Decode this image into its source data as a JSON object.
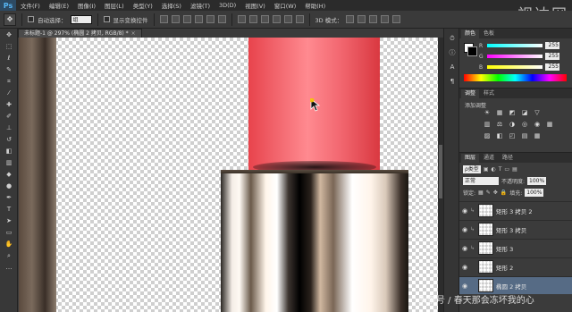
{
  "app": {
    "logo": "Ps",
    "menu": [
      "文件(F)",
      "编辑(E)",
      "图像(I)",
      "图层(L)",
      "类型(Y)",
      "选择(S)",
      "滤镜(T)",
      "3D(D)",
      "视图(V)",
      "窗口(W)",
      "帮助(H)"
    ],
    "window_controls": [
      "—",
      "□",
      "✕"
    ]
  },
  "options_bar": {
    "auto_select_label": "自动选择：",
    "auto_select_value": "组",
    "show_transform_label": "显示变换控件",
    "mode_3d_label": "3D 模式："
  },
  "watermark_top": "视达网",
  "document_tab": {
    "title": "未标题-1 @ 297% (椭圆 2 拷贝, RGB/8) *",
    "close": "×"
  },
  "color_panel": {
    "tabs": [
      "颜色",
      "色板"
    ],
    "channels": [
      {
        "label": "R",
        "value": "255",
        "gradient": "linear-gradient(90deg,#00ffff,#ffffff)"
      },
      {
        "label": "G",
        "value": "255",
        "gradient": "linear-gradient(90deg,#ff00ff,#ffffff)"
      },
      {
        "label": "B",
        "value": "255",
        "gradient": "linear-gradient(90deg,#ffff00,#ffffff)"
      }
    ]
  },
  "adjustments_panel": {
    "tabs": [
      "调整",
      "样式"
    ],
    "heading": "添加调整",
    "icons": [
      "☀",
      "▦",
      "◩",
      "◪",
      "▽",
      "",
      "▥",
      "⚖",
      "◑",
      "◎",
      "◉",
      "▦",
      "▨",
      "◧",
      "◰",
      "▤",
      "▦",
      ""
    ]
  },
  "layers_panel": {
    "tabs": [
      "图层",
      "通道",
      "路径"
    ],
    "filter_label": "ρ类型",
    "blend_mode": "正常",
    "opacity_label": "不透明度:",
    "opacity_value": "100%",
    "lock_label": "锁定:",
    "fill_label": "填充:",
    "fill_value": "100%",
    "layers": [
      {
        "name": "矩形 3 拷贝 2",
        "visible": true,
        "selected": false
      },
      {
        "name": "矩形 3 拷贝",
        "visible": true,
        "selected": false
      },
      {
        "name": "矩形 3",
        "visible": true,
        "selected": false
      },
      {
        "name": "矩形 2",
        "visible": true,
        "selected": false
      },
      {
        "name": "椭圆 2 拷贝",
        "visible": true,
        "selected": true
      }
    ]
  },
  "watermark_bottom": "头条号 / 春天那会冻坏我的心"
}
